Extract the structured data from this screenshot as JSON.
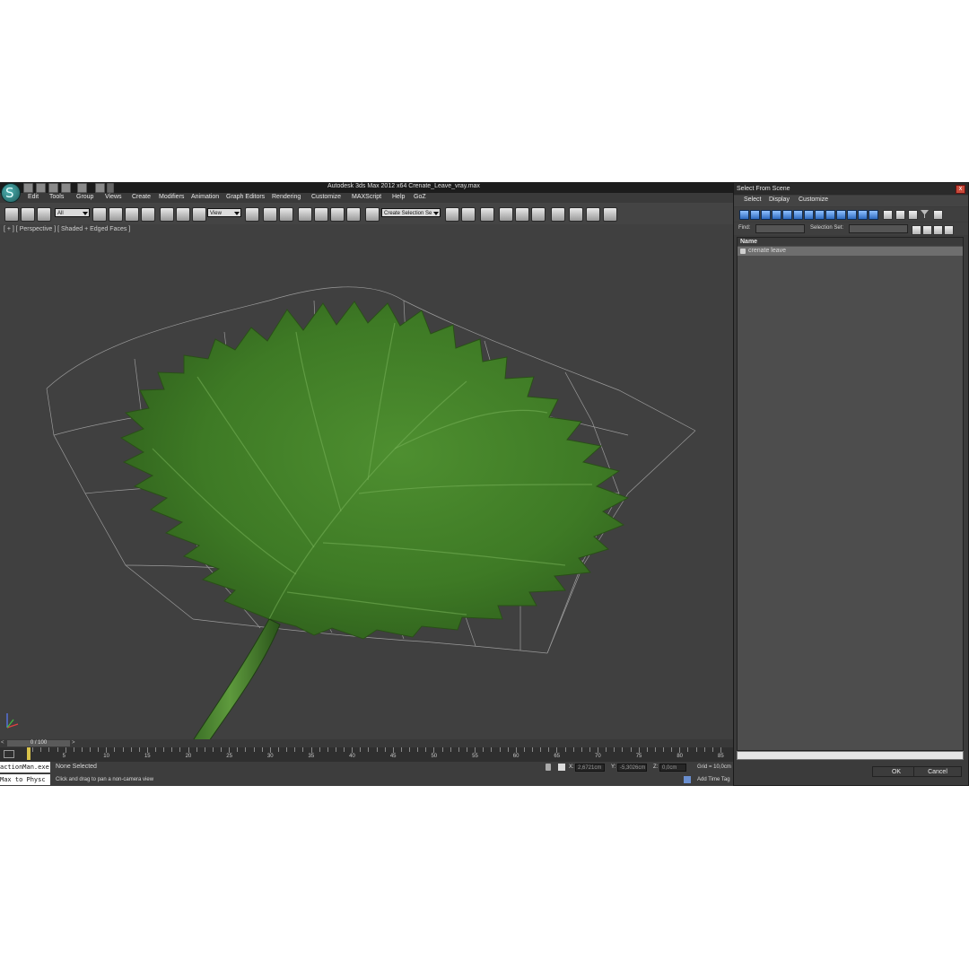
{
  "window": {
    "title": "Autodesk 3ds Max  2012 x64     Crenate_Leave_vray.max"
  },
  "menu": [
    "Edit",
    "Tools",
    "Group",
    "Views",
    "Create",
    "Modifiers",
    "Animation",
    "Graph Editors",
    "Rendering",
    "Customize",
    "MAXScript",
    "Help",
    "GoZ"
  ],
  "toolbar": {
    "selection_filter": "All",
    "reference_coord": "View",
    "named_selection": "Create Selection Se"
  },
  "viewport": {
    "label": "[ + ] [ Perspective ] [ Shaded + Edged Faces ]",
    "object": "crenate leave"
  },
  "timeline": {
    "frame_display": "0 / 100",
    "ticks": [
      "5",
      "10",
      "15",
      "20",
      "25",
      "30",
      "35",
      "40",
      "45",
      "50",
      "55",
      "60",
      "65",
      "70",
      "75",
      "80",
      "85"
    ]
  },
  "status": {
    "listener_1": "actionMan.exe",
    "listener_2": "Max to Physc",
    "selection": "None Selected",
    "prompt": "Click and drag to pan a non-camera view",
    "x_label": "X:",
    "x_value": "2,6721cm",
    "y_label": "Y:",
    "y_value": "-5,3026cm",
    "z_label": "Z:",
    "z_value": "0,0cm",
    "grid": "Grid = 10,0cm",
    "time_tag": "Add Time Tag"
  },
  "dialog": {
    "title": "Select From Scene",
    "close": "x",
    "menu": [
      "Select",
      "Display",
      "Customize"
    ],
    "find_label": "Find:",
    "selection_set_label": "Selection Set:",
    "column_name": "Name",
    "items": [
      "crenate leave"
    ],
    "ok": "OK",
    "cancel": "Cancel"
  },
  "colors": {
    "viewport_bg": "#404040",
    "leaf_green": "#3f7a26",
    "ui_dark": "#2b2b2b",
    "dialog_blue_button": "#2f6bc0"
  }
}
